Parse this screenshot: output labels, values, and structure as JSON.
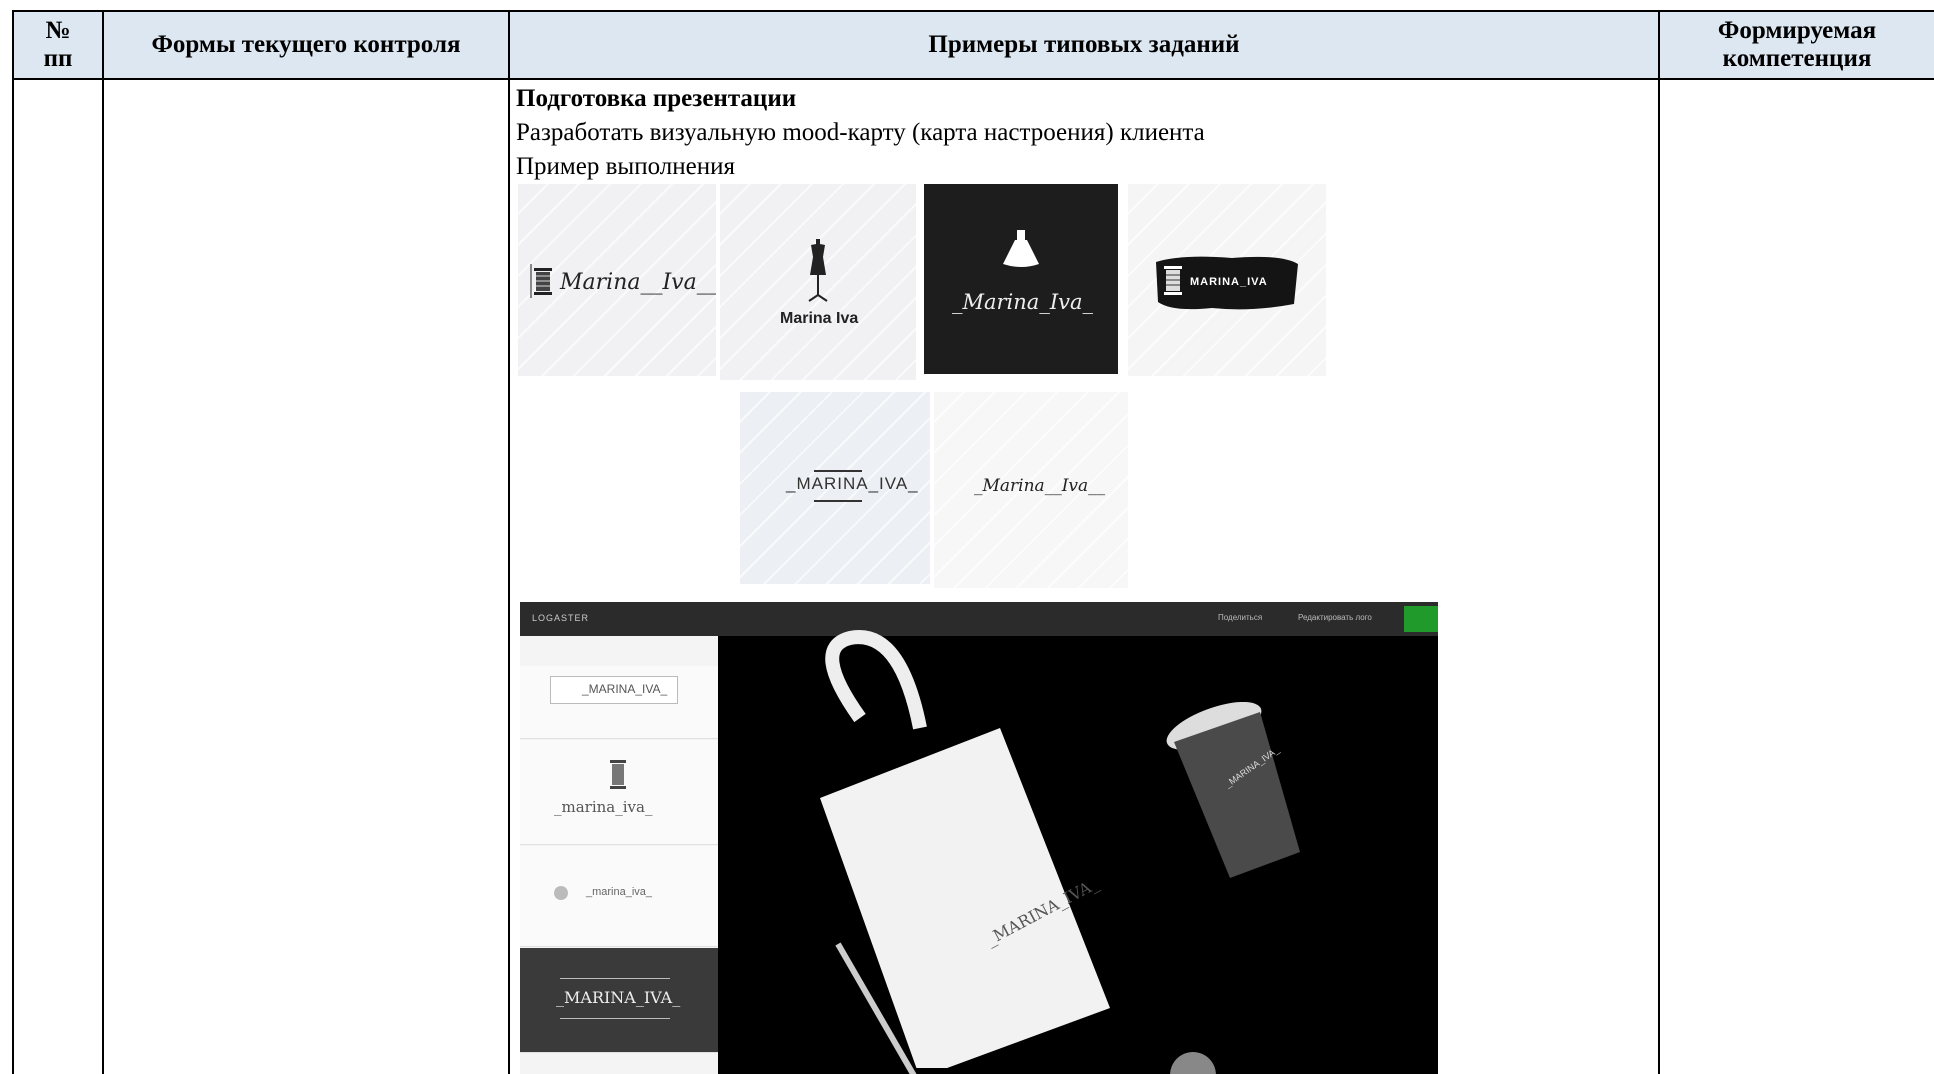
{
  "table": {
    "headers": {
      "num": "№ пп",
      "forms": "Формы текущего контроля",
      "examples": "Примеры типовых заданий",
      "competence": "Формируемая компетенция"
    }
  },
  "content": {
    "heading": "Подготовка презентации",
    "task": "Разработать визуальную  mood-карту (карта настроения) клиента",
    "example_label": "Пример выполнения"
  },
  "logos": [
    {
      "text": "Marina__Iva__",
      "icon": "thread-spool-icon"
    },
    {
      "text": "Marina Iva",
      "icon": "dress-mannequin-icon"
    },
    {
      "text": "_Marina_Iva_",
      "icon": "dress-icon"
    },
    {
      "text": "MARINA_IVA",
      "icon": "thread-spool-icon"
    },
    {
      "text": "_MARINA_IVA_"
    },
    {
      "text": "_Marina__Iva__"
    }
  ],
  "screenshot": {
    "brand": "LOGASTER",
    "toolbar": [
      "Поделиться",
      "Редактировать лого"
    ],
    "side_items": [
      "_MARINA_IVA_",
      "_marina_iva_",
      "_marina_iva_",
      "_MARINA_IVA_"
    ],
    "bag_text": "_MARINA_IVA_",
    "cup_text": "_MARINA_IVA_"
  },
  "colors": {
    "header_bg": "#dde7f1",
    "dark_tile": "#1d1d1d",
    "accent_green": "#1f9a2b"
  }
}
